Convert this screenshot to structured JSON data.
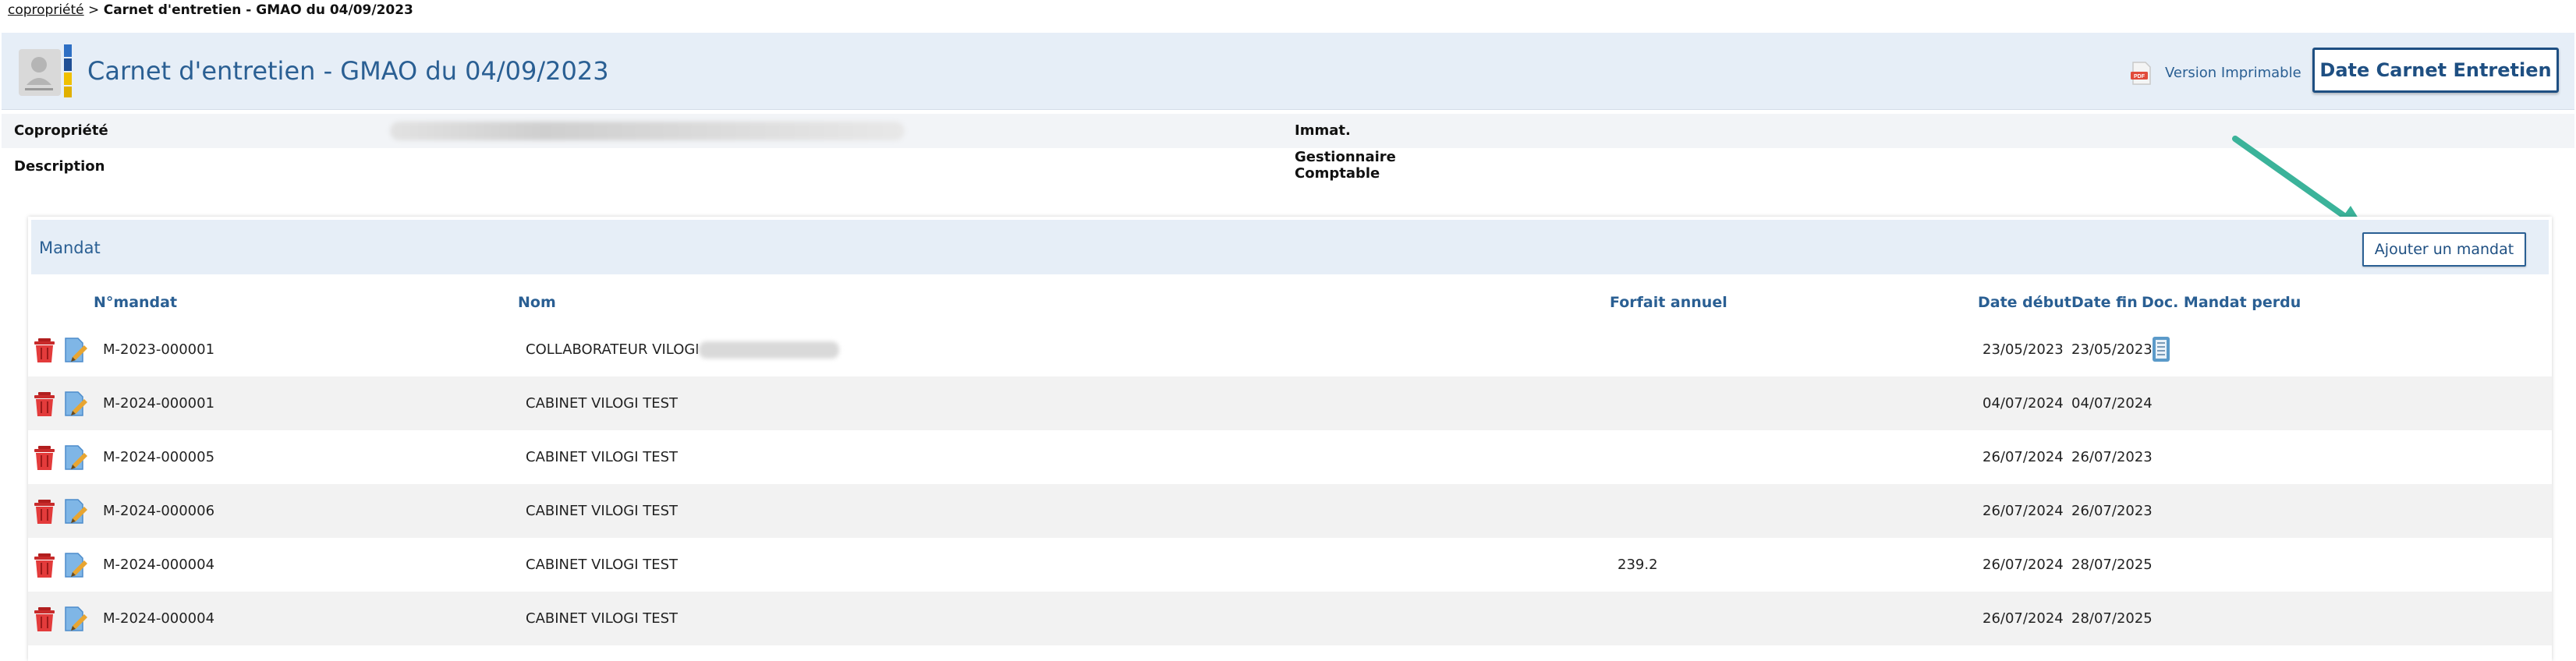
{
  "breadcrumb": {
    "link": "copropriété",
    "separator": " > ",
    "current": "Carnet d'entretien - GMAO du 04/09/2023"
  },
  "header": {
    "title": "Carnet d'entretien - GMAO du 04/09/2023",
    "print_label": "Version Imprimable",
    "primary_button": "Date Carnet Entretien"
  },
  "info": {
    "copropriete_label": "Copropriété",
    "description_label": "Description",
    "immat_label": "Immat.",
    "gestionnaire_label_1": "Gestionnaire",
    "gestionnaire_label_2": "Comptable"
  },
  "mandat": {
    "title": "Mandat",
    "add_button": "Ajouter un mandat",
    "columns": {
      "num": "N°mandat",
      "nom": "Nom",
      "forfait": "Forfait annuel",
      "debut": "Date début",
      "fin": "Date fin",
      "doc": "Doc. Mandat perdu"
    },
    "rows": [
      {
        "num": "M-2023-000001",
        "nom": "COLLABORATEUR VILOGI -",
        "forfait": "",
        "debut": "23/05/2023",
        "fin": "23/05/2023",
        "doc": true
      },
      {
        "num": "M-2024-000001",
        "nom": "CABINET VILOGI TEST",
        "forfait": "",
        "debut": "04/07/2024",
        "fin": "04/07/2024",
        "doc": false
      },
      {
        "num": "M-2024-000005",
        "nom": "CABINET VILOGI TEST",
        "forfait": "",
        "debut": "26/07/2024",
        "fin": "26/07/2023",
        "doc": false
      },
      {
        "num": "M-2024-000006",
        "nom": "CABINET VILOGI TEST",
        "forfait": "",
        "debut": "26/07/2024",
        "fin": "26/07/2023",
        "doc": false
      },
      {
        "num": "M-2024-000004",
        "nom": "CABINET VILOGI TEST",
        "forfait": "239.2",
        "debut": "26/07/2024",
        "fin": "28/07/2025",
        "doc": false
      },
      {
        "num": "M-2024-000004",
        "nom": "CABINET VILOGI TEST",
        "forfait": "",
        "debut": "26/07/2024",
        "fin": "28/07/2025",
        "doc": false
      }
    ]
  },
  "colors": {
    "accent": "#2a5f93",
    "band": "#e6eef7",
    "arrow": "#3bb39a"
  }
}
